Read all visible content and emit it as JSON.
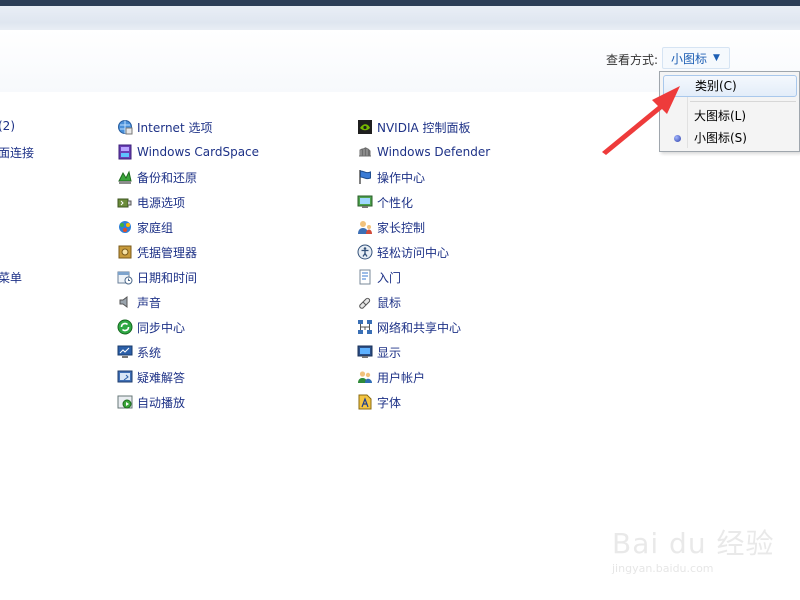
{
  "view": {
    "label": "查看方式:",
    "selected": "小图标"
  },
  "menu": {
    "items": [
      {
        "label": "类别(C)",
        "highlighted": true,
        "checked": false
      },
      {
        "label": "大图标(L)",
        "highlighted": false,
        "checked": false
      },
      {
        "label": "小图标(S)",
        "highlighted": false,
        "checked": true
      }
    ]
  },
  "left_partial": [
    "(2)",
    "面连接",
    "菜单"
  ],
  "columns": {
    "col1": [
      {
        "label": "Internet 选项",
        "icon": "internet-options-icon"
      },
      {
        "label": "Windows CardSpace",
        "icon": "cardspace-icon"
      },
      {
        "label": "备份和还原",
        "icon": "backup-restore-icon"
      },
      {
        "label": "电源选项",
        "icon": "power-options-icon"
      },
      {
        "label": "家庭组",
        "icon": "homegroup-icon"
      },
      {
        "label": "凭据管理器",
        "icon": "credential-manager-icon"
      },
      {
        "label": "日期和时间",
        "icon": "date-time-icon"
      },
      {
        "label": "声音",
        "icon": "sound-icon"
      },
      {
        "label": "同步中心",
        "icon": "sync-center-icon"
      },
      {
        "label": "系统",
        "icon": "system-icon"
      },
      {
        "label": "疑难解答",
        "icon": "troubleshooting-icon"
      },
      {
        "label": "自动播放",
        "icon": "autoplay-icon"
      }
    ],
    "col2": [
      {
        "label": "NVIDIA 控制面板",
        "icon": "nvidia-icon"
      },
      {
        "label": "Windows Defender",
        "icon": "defender-icon"
      },
      {
        "label": "操作中心",
        "icon": "action-center-icon"
      },
      {
        "label": "个性化",
        "icon": "personalization-icon"
      },
      {
        "label": "家长控制",
        "icon": "parental-controls-icon"
      },
      {
        "label": "轻松访问中心",
        "icon": "ease-of-access-icon"
      },
      {
        "label": "入门",
        "icon": "getting-started-icon"
      },
      {
        "label": "鼠标",
        "icon": "mouse-icon"
      },
      {
        "label": "网络和共享中心",
        "icon": "network-sharing-icon"
      },
      {
        "label": "显示",
        "icon": "display-icon"
      },
      {
        "label": "用户帐户",
        "icon": "user-accounts-icon"
      },
      {
        "label": "字体",
        "icon": "fonts-icon"
      }
    ]
  },
  "watermark": {
    "line1": "Bai du 经验",
    "line2": "jingyan.baidu.com"
  },
  "colors": {
    "link": "#1e3287",
    "accent_blue": "#1e5fb4",
    "arrow_red": "#ee3b3b"
  }
}
